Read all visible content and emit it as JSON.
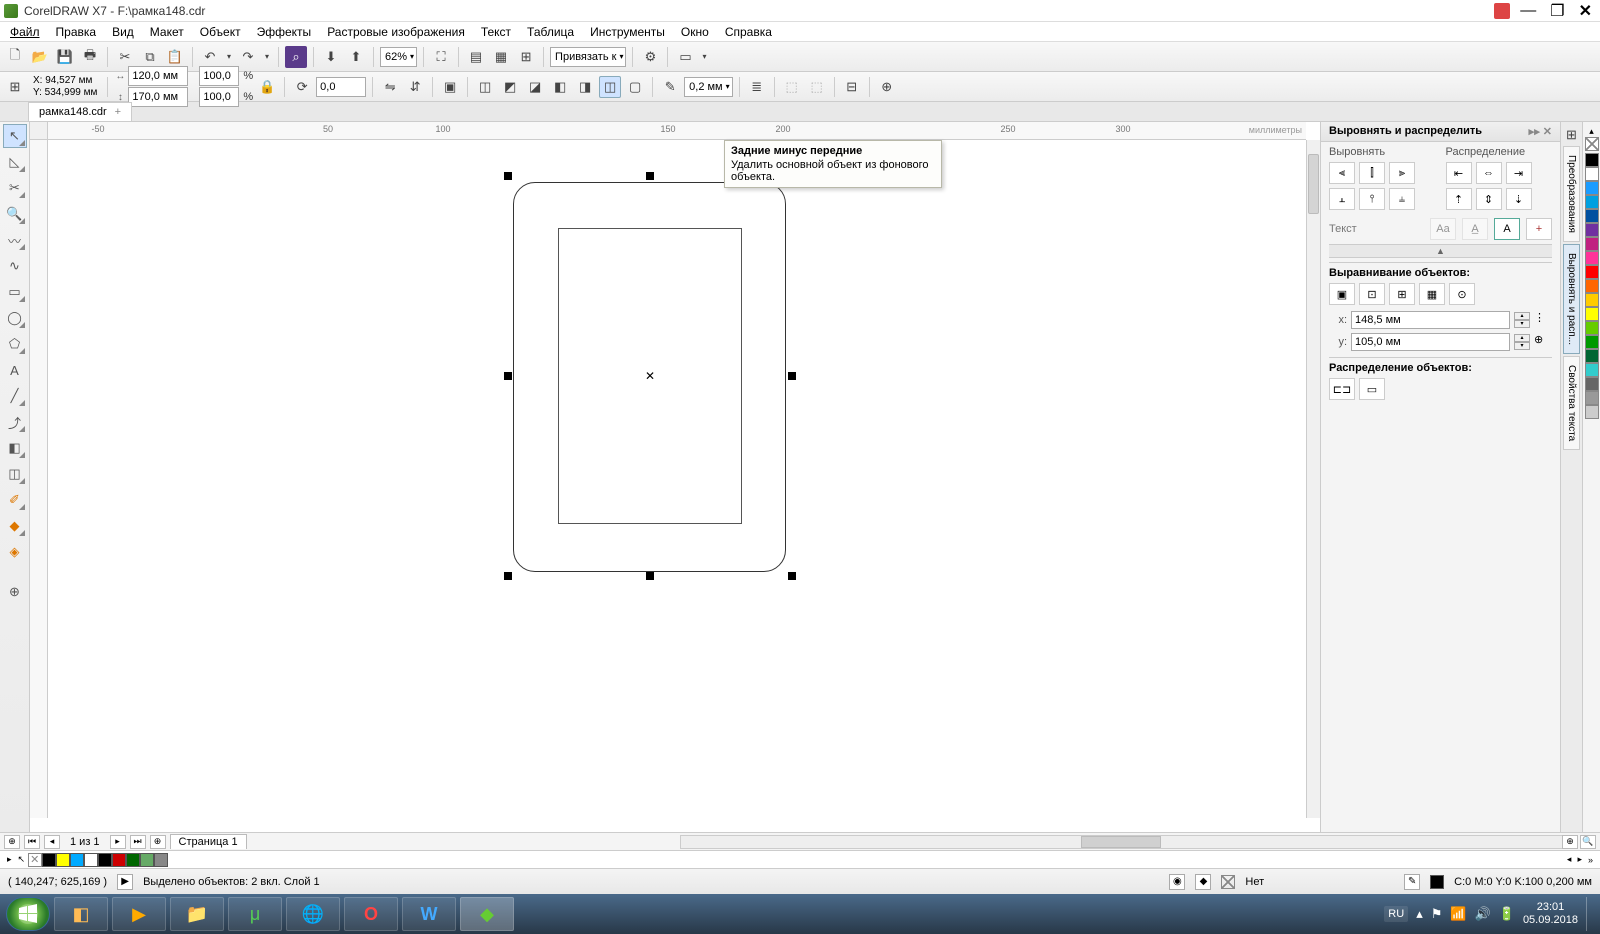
{
  "app": {
    "title": "CorelDRAW X7 - F:\\рамка148.cdr"
  },
  "menu": [
    "Файл",
    "Правка",
    "Вид",
    "Макет",
    "Объект",
    "Эффекты",
    "Растровые изображения",
    "Текст",
    "Таблица",
    "Инструменты",
    "Окно",
    "Справка"
  ],
  "tb1": {
    "zoom": "62%",
    "snap": "Привязать к"
  },
  "tb2": {
    "x": "X: 94,527 мм",
    "y": "Y: 534,999 мм",
    "w": "120,0 мм",
    "h": "170,0 мм",
    "sx": "100,0",
    "sy": "100,0",
    "angle": "0,0",
    "outline": "0,2 мм"
  },
  "doc": {
    "tab": "рамка148.cdr"
  },
  "ruler": {
    "h": [
      "-50",
      "50",
      "100",
      "150",
      "200",
      "250",
      "300"
    ],
    "unit": "миллиметры"
  },
  "tooltip": {
    "title": "Задние минус передние",
    "body": "Удалить основной объект из фонового объекта."
  },
  "dock": {
    "title": "Выровнять и распределить",
    "col1": "Выровнять",
    "col2": "Распределение",
    "text_label": "Текст",
    "align_obj": "Выравнивание объектов:",
    "x_val": "148,5 мм",
    "y_val": "105,0 мм",
    "dist_obj": "Распределение объектов:"
  },
  "vtabs": [
    "Преобразования",
    "Выровнять и расп...",
    "Свойства текста"
  ],
  "hsb": {
    "pages": "1 из 1",
    "page_tab": "Страница 1"
  },
  "status": {
    "coords": "( 140,247; 625,169 )",
    "selection": "Выделено объектов: 2 вкл. Слой 1",
    "fill": "Нет",
    "outline": "C:0 M:0 Y:0 K:100  0,200 мм"
  },
  "tray": {
    "lang": "RU",
    "time": "23:01",
    "date": "05.09.2018"
  }
}
